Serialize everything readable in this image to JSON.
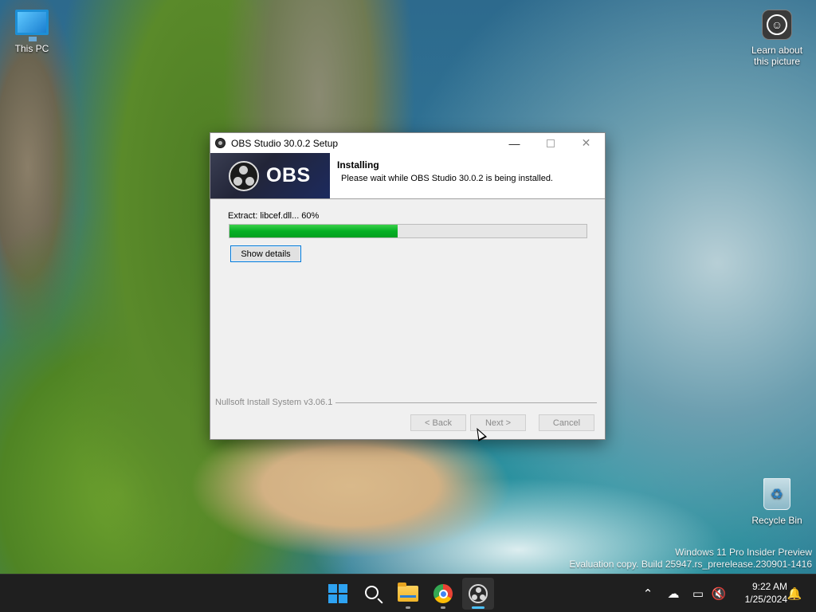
{
  "desktop": {
    "icons": {
      "this_pc": "This PC",
      "learn": "Learn about this picture",
      "recycle_bin": "Recycle Bin"
    },
    "watermark": {
      "line1": "Windows 11 Pro Insider Preview",
      "line2": "Evaluation copy. Build 25947.rs_prerelease.230901-1416"
    }
  },
  "installer": {
    "title": "OBS Studio 30.0.2 Setup",
    "logo_text": "OBS",
    "header_title": "Installing",
    "header_subtitle": "Please wait while OBS Studio 30.0.2 is being installed.",
    "status": "Extract: libcef.dll... 60%",
    "progress_fraction": 0.47,
    "show_details_label": "Show details",
    "branding": "Nullsoft Install System v3.06.1",
    "buttons": {
      "back": "< Back",
      "next": "Next >",
      "cancel": "Cancel"
    }
  },
  "taskbar": {
    "apps": [
      "start-icon",
      "search-icon",
      "file-explorer-icon",
      "chrome-icon",
      "obs-icon"
    ],
    "active_app": "obs-icon",
    "tray": [
      "chevron-up-icon",
      "onedrive-icon",
      "network-icon",
      "volume-muted-icon",
      "notification-bell-icon"
    ],
    "clock": {
      "time": "9:22 AM",
      "date": "1/25/2024"
    }
  },
  "colors": {
    "progress_fill": "#06b025",
    "accent": "#0078d7",
    "taskbar": "#1f1f1f"
  }
}
